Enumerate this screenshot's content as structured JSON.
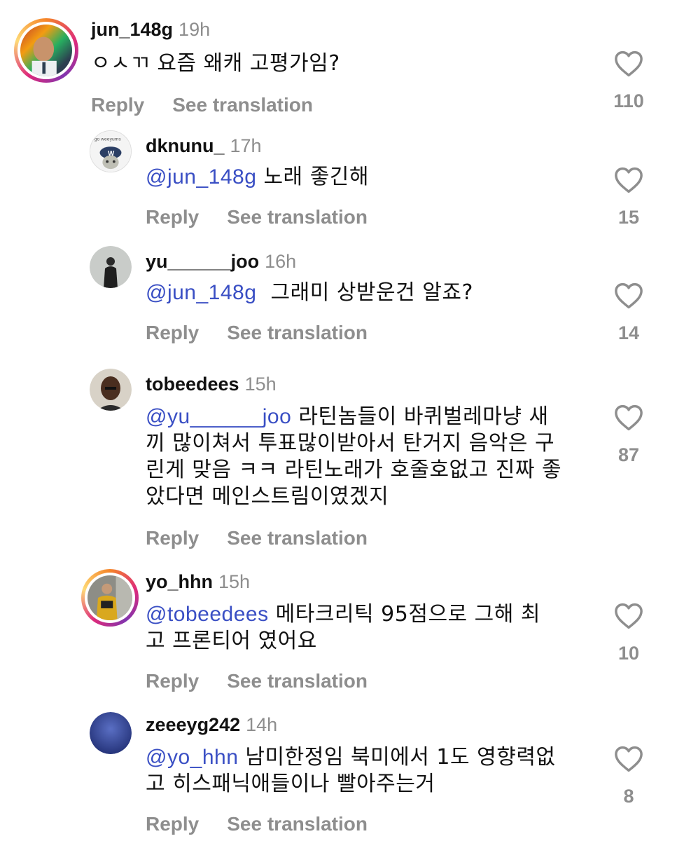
{
  "comments": [
    {
      "username": "jun_148g",
      "time": "19h",
      "mention": "",
      "text": "ㅇㅅㄲ 요즘 왜캐 고평가임?",
      "likes": "110",
      "reply_label": "Reply",
      "translate_label": "See translation",
      "avatar": "baby-photo-avatar",
      "story_ring": true
    },
    {
      "username": "dknunu_",
      "time": "17h",
      "mention": "@jun_148g",
      "text": " 노래 좋긴해",
      "likes": "15",
      "reply_label": "Reply",
      "translate_label": "See translation",
      "avatar": "cap-cat-avatar",
      "story_ring": false
    },
    {
      "username": "yu______joo",
      "time": "16h",
      "mention": "@jun_148g",
      "text": "  그래미 상받운건 알죠?",
      "likes": "14",
      "reply_label": "Reply",
      "translate_label": "See translation",
      "avatar": "dark-figure-avatar",
      "story_ring": false
    },
    {
      "username": "tobeedees",
      "time": "15h",
      "mention": "@yu______joo",
      "text": " 라틴놈들이 바퀴벌레마냥 새\n끼 많이쳐서 투표많이받아서 탄거지 음악은 구\n린게 맞음 ㅋㅋ 라틴노래가 호줄호없고 진짜 좋\n았다면 메인스트림이였겠지",
      "likes": "87",
      "reply_label": "Reply",
      "translate_label": "See translation",
      "avatar": "man-portrait-avatar",
      "story_ring": false
    },
    {
      "username": "yo_hhn",
      "time": "15h",
      "mention": "@tobeedees",
      "text": " 메타크리틱 95점으로 그해 최\n고 프론티어 였어요",
      "likes": "10",
      "reply_label": "Reply",
      "translate_label": "See translation",
      "avatar": "jersey-person-avatar",
      "story_ring": true
    },
    {
      "username": "zeeeyg242",
      "time": "14h",
      "mention": "@yo_hhn",
      "text": " 남미한정임 북미에서 1도 영향력없\n고 히스패닉애들이나 빨아주는거",
      "likes": "8",
      "reply_label": "Reply",
      "translate_label": "See translation",
      "avatar": "blue-sky-avatar",
      "story_ring": false
    }
  ],
  "colors": {
    "mention": "#3a4fc4",
    "muted": "#8e8e8e",
    "text": "#111111"
  }
}
